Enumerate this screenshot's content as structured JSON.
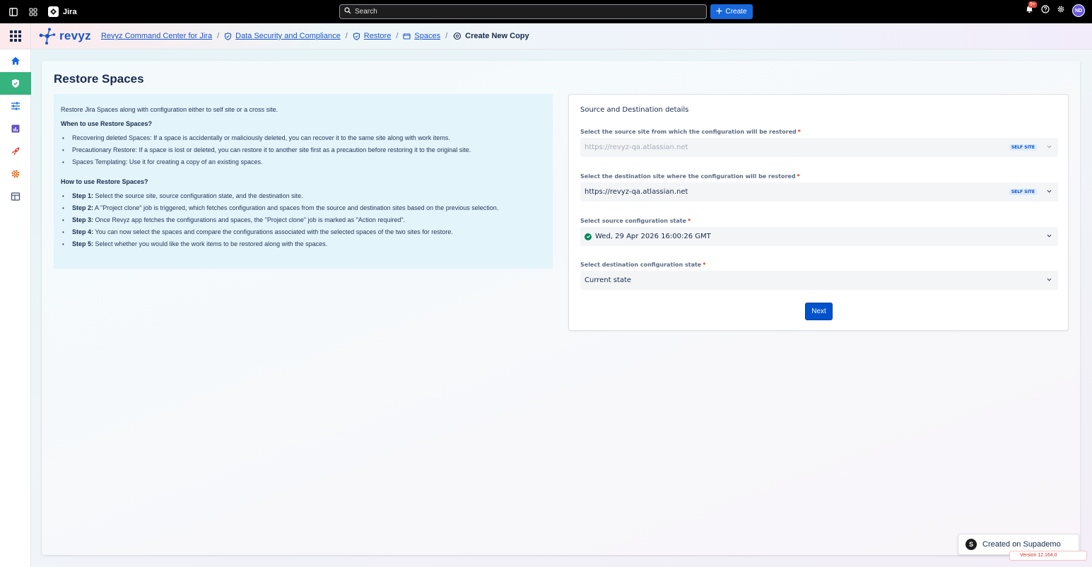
{
  "topbar": {
    "app_name": "Jira",
    "search_placeholder": "Search",
    "create_label": "Create",
    "notification_count": "9+",
    "avatar_initials": "ND"
  },
  "header": {
    "logo_text": "revyz",
    "breadcrumbs": [
      {
        "label": "Revyz Command Center for Jira"
      },
      {
        "label": "Data Security and Compliance"
      },
      {
        "label": "Restore"
      },
      {
        "label": "Spaces"
      }
    ],
    "current": "Create New Copy"
  },
  "sidebar": {
    "items": [
      {
        "icon": "home-icon",
        "color": "#1868db"
      },
      {
        "icon": "shield-check-icon",
        "color": "#36b37e"
      },
      {
        "icon": "sliders-icon",
        "color": "#1868db"
      },
      {
        "icon": "bar-chart-icon",
        "color": "#6554c0"
      },
      {
        "icon": "rocket-icon",
        "color": "#e2483d"
      },
      {
        "icon": "gear-icon",
        "color": "#e56910"
      },
      {
        "icon": "table-icon",
        "color": "#44546f"
      }
    ]
  },
  "page": {
    "title": "Restore Spaces"
  },
  "info": {
    "intro": "Restore Jira Spaces along with configuration either to self site or a cross site.",
    "when_heading": "When to use Restore Spaces?",
    "when_items": [
      "Recovering deleted Spaces: If a space is accidentally or maliciously deleted, you can recover it to the same site along with work items.",
      "Precautionary Restore: If a space is lost or deleted, you can restore it to another site first as a precaution before restoring it to the original site.",
      "Spaces Templating: Use it for creating a copy of an existing spaces."
    ],
    "how_heading": "How to use Restore Spaces?",
    "steps": [
      {
        "label": "Step 1:",
        "text": " Select the source site, source configuration state, and the destination site."
      },
      {
        "label": "Step 2:",
        "text": " A \"Project clone\" job is triggered, which fetches configuration and spaces from the source and destination sites based on the previous selection."
      },
      {
        "label": "Step 3:",
        "text": " Once Revyz app fetches the configurations and spaces, the \"Project clone\" job is marked as \"Action required\"."
      },
      {
        "label": "Step 4:",
        "text": " You can now select the spaces and compare the configurations associated with the selected spaces of the two sites for restore."
      },
      {
        "label": "Step 5:",
        "text": " Select whether you would like the work items to be restored along with the spaces."
      }
    ]
  },
  "form": {
    "title": "Source and Destination details",
    "source_site": {
      "label": "Select the source site from which the configuration will be restored",
      "value": "https://revyz-qa.atlassian.net",
      "tag": "SELF SITE"
    },
    "dest_site": {
      "label": "Select the destination site where the configuration will be restored",
      "value": "https://revyz-qa.atlassian.net",
      "tag": "SELF SITE"
    },
    "source_state": {
      "label": "Select source configuration state",
      "value": "Wed, 29 Apr 2026 16:00:26 GMT"
    },
    "dest_state": {
      "label": "Select destination configuration state",
      "value": "Current state"
    },
    "required_mark": "*",
    "next_label": "Next"
  },
  "footer": {
    "supademo_label": "Created on Supademo",
    "version_text": "Version 12.164.0"
  }
}
